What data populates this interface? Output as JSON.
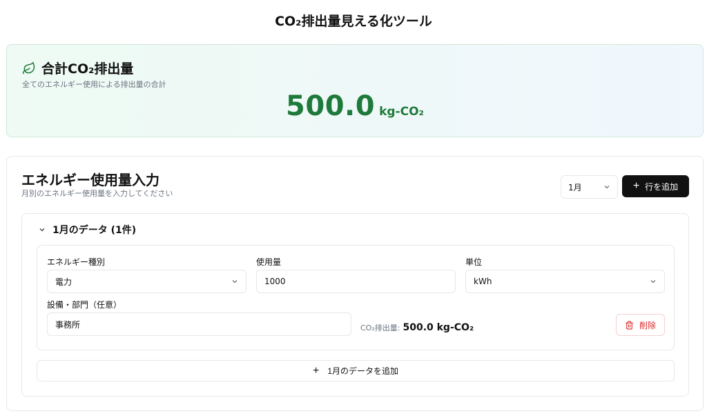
{
  "app": {
    "title": "CO₂排出量見える化ツール"
  },
  "total": {
    "title": "合計CO₂排出量",
    "description": "全てのエネルギー使用による排出量の合計",
    "value": "500.0",
    "unit": "kg-CO₂",
    "icon": "leaf-icon",
    "accent_color": "#1e7a3a"
  },
  "input_section": {
    "title": "エネルギー使用量入力",
    "description": "月別のエネルギー使用量を入力してください",
    "month_select": {
      "value": "1月"
    },
    "add_row_label": "行を追加",
    "month_group": {
      "title": "1月のデータ (1件)",
      "rows": [
        {
          "energy_type_label": "エネルギー種別",
          "energy_type_value": "電力",
          "usage_label": "使用量",
          "usage_value": "1000",
          "unit_label": "単位",
          "unit_value": "kWh",
          "department_label": "設備・部門（任意）",
          "department_value": "事務所",
          "co2_label": "CO₂排出量:",
          "co2_value": "500.0 kg-CO₂",
          "delete_label": "削除"
        }
      ],
      "add_month_data_label": "1月のデータを追加"
    }
  }
}
